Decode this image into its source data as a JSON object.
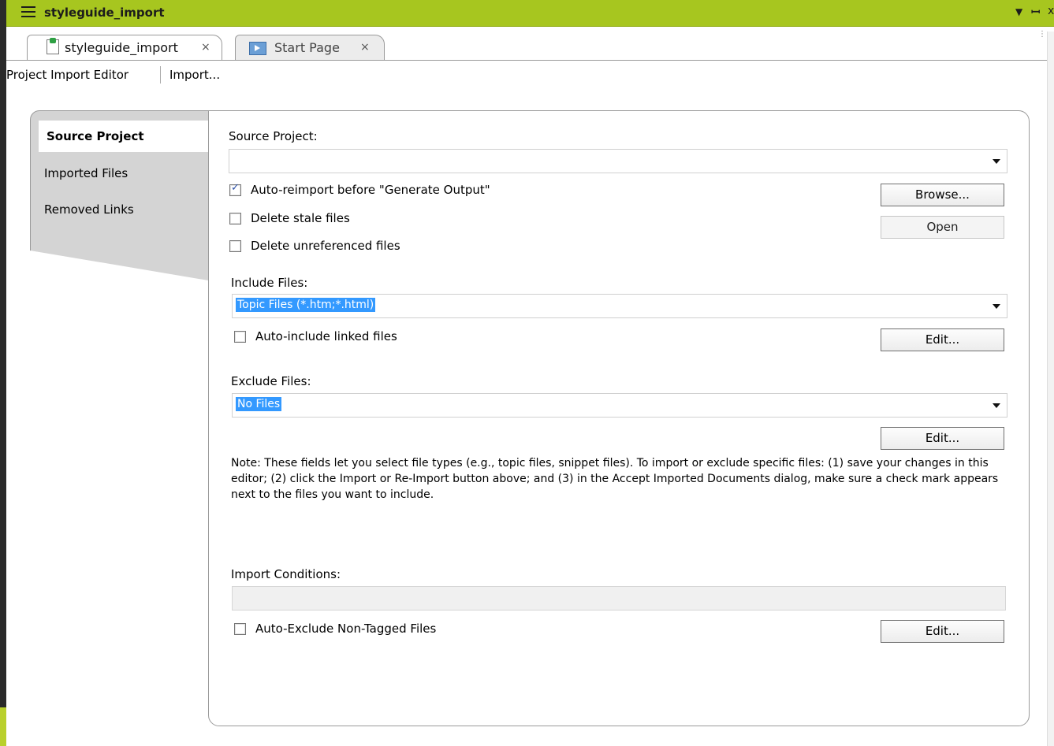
{
  "window": {
    "title": "styleguide_import",
    "dropdown_glyph": "▼",
    "pin_glyph": "ᵾ",
    "close_glyph": "x"
  },
  "tabs": [
    {
      "label": "styleguide_import",
      "close": "×",
      "icon": "import-project-icon"
    },
    {
      "label": "Start Page",
      "close": "×",
      "icon": "start-page-icon"
    }
  ],
  "toolbar": {
    "editor_label": "Project Import Editor",
    "import_label": "Import..."
  },
  "side_tabs": [
    {
      "label": "Source Project"
    },
    {
      "label": "Imported Files"
    },
    {
      "label": "Removed Links"
    }
  ],
  "source": {
    "label": "Source Project:",
    "value": "",
    "browse_label": "Browse...",
    "open_label": "Open",
    "auto_reimport": {
      "label": "Auto-reimport before \"Generate Output\"",
      "checked": true
    },
    "delete_stale": {
      "label": "Delete stale files",
      "checked": false
    },
    "delete_unref": {
      "label": "Delete unreferenced files",
      "checked": false
    }
  },
  "include": {
    "label": "Include Files:",
    "value": "Topic Files (*.htm;*.html)",
    "auto_include": {
      "label": "Auto-include linked files",
      "checked": false
    },
    "edit_label": "Edit..."
  },
  "exclude": {
    "label": "Exclude Files:",
    "value": "No Files",
    "edit_label": "Edit..."
  },
  "note": "Note: These fields let you select file types (e.g., topic files, snippet files). To import or exclude specific files: (1) save your changes in this editor; (2) click the Import or Re-Import button above; and (3) in the Accept Imported Documents dialog, make sure a check mark appears next to the files you want to include.",
  "conditions": {
    "label": "Import Conditions:",
    "value": "",
    "auto_exclude": {
      "label": "Auto-Exclude Non-Tagged Files",
      "checked": false
    },
    "edit_label": "Edit..."
  },
  "colors": {
    "titlebar": "#a7c61f",
    "selection": "#3399ff",
    "side_tab_bg": "#d4d4d4"
  }
}
